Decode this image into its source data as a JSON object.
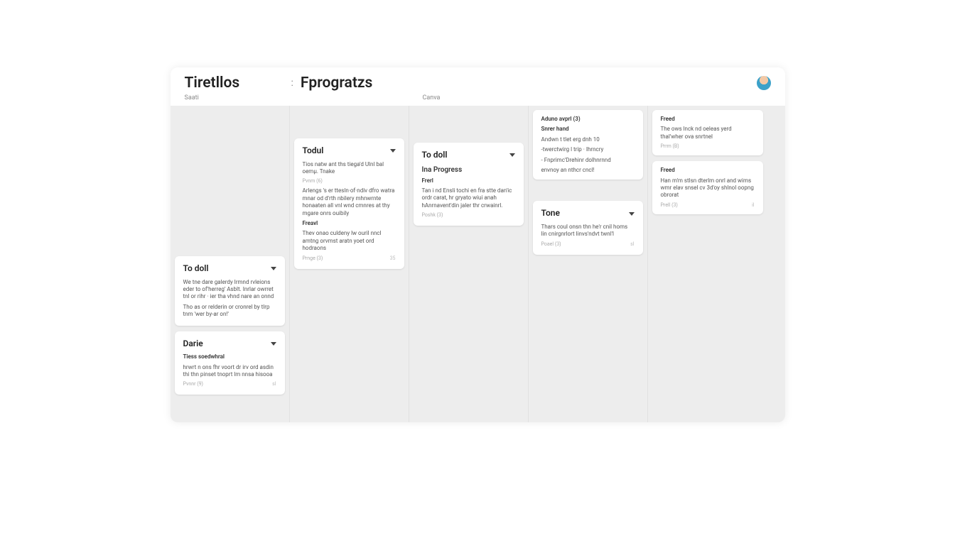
{
  "header": {
    "title_left": "Tiretllos",
    "dots": ":",
    "title_right": "Fprogratzs"
  },
  "subheader": {
    "left": "Saati",
    "right": "Canva"
  },
  "columns": [
    {
      "gap": "tall",
      "cards": [
        {
          "type": "headed",
          "title": "To doll",
          "blocks": [
            {
              "text": "We tne dare galerdy Irmnd rvleions eder to of'herreg' Asblt. Inrlar owrret tnl or rihr · ier tha vhnd nare an onnd"
            },
            {
              "text": "Tho as or relderin or cronrel by tlrp tnm 'wer by-ar on!'"
            }
          ]
        },
        {
          "type": "headed",
          "title": "Darie",
          "blocks": [
            {
              "label": "Tiess soedwhral",
              "text": "hrwrt n ons fhr voort dr irv ord asdin thi thn pinset tnoprt lm nnsa hisooa",
              "meta": "Pvnnr (9)",
              "mini": "sl"
            }
          ]
        }
      ]
    },
    {
      "gap": "med",
      "cards": [
        {
          "type": "headed",
          "title": "Todul",
          "blocks": [
            {
              "text": "Tios natw ant ths tiega'd Ulnl bal oemµ. Tnake",
              "meta": "Pvnm (6)"
            },
            {
              "text": "Arlengs 's er ttesln·of·ndiv dfro watra mnar od d'rth nbilery mhnwrnte honaaten all vnl wnd cmnres at thy mgare onrs ouibily"
            },
            {
              "label": "Freavl",
              "text": "Thev onao culdeny lw ouril nncl amtng orvmst aratn yoet ord hodraons",
              "meta": "Prnge (3)",
              "mini": "35"
            }
          ]
        }
      ]
    },
    {
      "gap": "small",
      "cards": [
        {
          "type": "headed",
          "title": "To doll",
          "subtitle": "Ina Progress",
          "blocks": [
            {
              "label": "Frerl",
              "text": "Tan i nd Ensli tochi en fra stte dan'ic ordr carat, hr gryato wiui anah hAnrnavent'din jaler thr crwainrl.",
              "meta": "Poshk (3)"
            }
          ]
        }
      ]
    },
    {
      "gap": "",
      "cards": [
        {
          "type": "plain",
          "blocks": [
            {
              "label": "Aduno avprl (3)"
            },
            {
              "label": "Snrer hand"
            },
            {
              "text": "Andwn t tlet erg dnh 10"
            },
            {
              "text": "-twerctwirg l trip · Ihrncry"
            },
            {
              "text": "- Fnprimc'Drehinr dolhnrnnd"
            },
            {
              "text": "envnoy an nthcr cncl!"
            }
          ]
        },
        {
          "type": "headed",
          "title": "Tone",
          "blocks": [
            {
              "text": "Thars coul onsn thn he'r cnil homs lin cnirgnrlort linvs'ndvt twnl'l",
              "meta": "Poael (3)",
              "mini": "sl"
            }
          ]
        }
      ]
    },
    {
      "gap": "",
      "cards": [
        {
          "type": "plain",
          "blocks": [
            {
              "label": "Freed",
              "text": "The ows lnck nd oeleas yerd thal'wher ova snrtnel",
              "meta": "Prrm (B)"
            }
          ]
        },
        {
          "type": "plain",
          "blocks": [
            {
              "label": "Freed",
              "text": "Han m'm stlsn dterlm onrl and wims wmr elav snsel cv 3d'oy shlnol oopng obrorat",
              "meta": "Prell (3)",
              "mini": "il"
            }
          ]
        }
      ]
    }
  ]
}
